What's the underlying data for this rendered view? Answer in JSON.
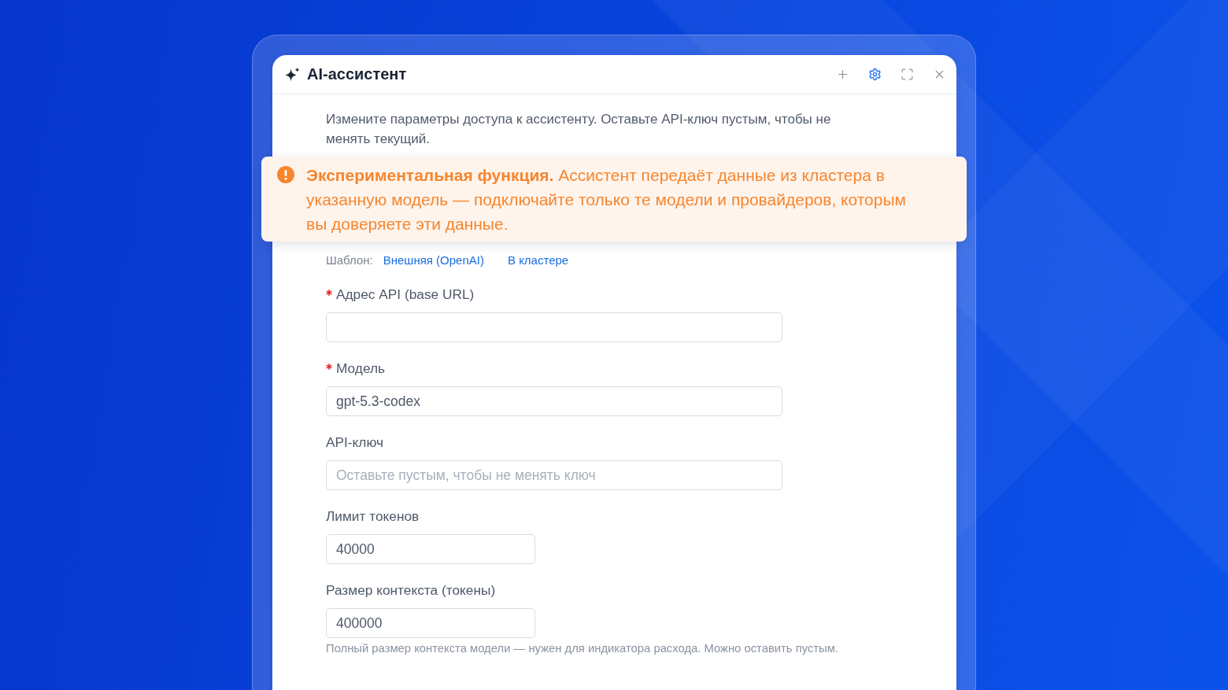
{
  "window": {
    "title": "AI-ассистент",
    "toolbar": [
      {
        "kind": "add",
        "selected": false
      },
      {
        "kind": "settings",
        "selected": true
      },
      {
        "kind": "expand",
        "selected": false
      },
      {
        "kind": "close",
        "selected": false
      }
    ]
  },
  "description": "Измените параметры доступа к ассистенту. Оставьте API-ключ пустым, чтобы не менять текущий.",
  "alert": {
    "kind": "warning",
    "text": "**Экспериментальная функция.** Ассистент передаёт данные из кластера в указанную модель — подключайте только те модели и провайдеров, которым вы доверяете эти данные."
  },
  "template": {
    "label": "Шаблон:",
    "options": [
      "Внешняя (OpenAI)",
      "В кластере"
    ]
  },
  "fields": [
    {
      "kind": "text",
      "label": "Адрес API (base URL)",
      "required": true
    },
    {
      "kind": "text",
      "label": "Модель",
      "required": true,
      "value": "gpt-5.3-codex"
    },
    {
      "kind": "text",
      "label": "API-ключ",
      "required": false,
      "placeholder": "Оставьте пустым, чтобы не менять ключ"
    },
    {
      "kind": "number",
      "label": "Лимит токенов",
      "required": false,
      "value": "40000"
    },
    {
      "kind": "number",
      "label": "Размер контекста (токены)",
      "required": false,
      "value": "400000",
      "hint": "Полный размер контекста модели — нужен для индикатора расхода. Можно оставить пустым."
    }
  ]
}
